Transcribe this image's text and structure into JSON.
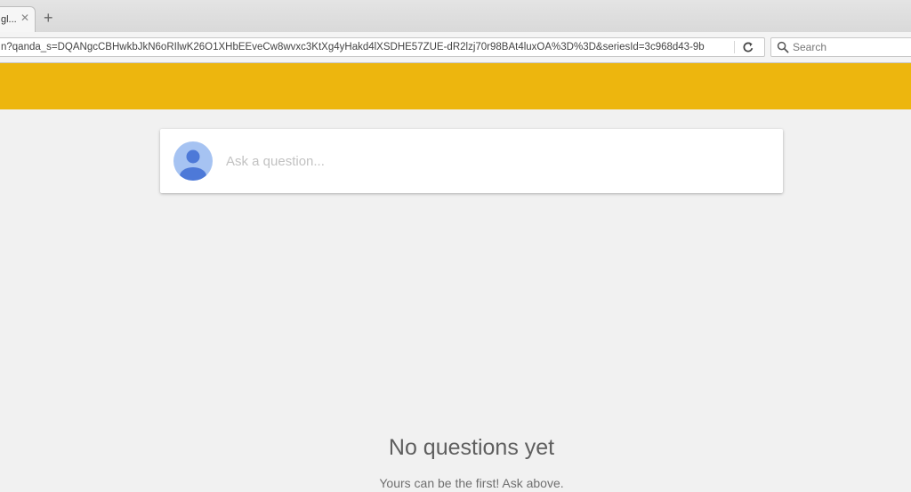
{
  "tab": {
    "title": "gl...",
    "close_glyph": "✕",
    "new_tab_glyph": "+"
  },
  "toolbar": {
    "url": "n?qanda_s=DQANgcCBHwkbJkN6oRIlwK26O1XHbEEveCw8wvxc3KtXg4yHakd4lXSDHE57ZUE-dR2lzj70r98BAt4luxOA%3D%3D&seriesId=3c968d43-9b",
    "reload_icon": "reload-icon",
    "search_placeholder": "Search",
    "search_icon": "search-icon"
  },
  "page": {
    "header_color": "#edb60e",
    "ask_placeholder": "Ask a question...",
    "avatar_icon": "user-avatar-icon",
    "empty_title": "No questions yet",
    "empty_subtitle": "Yours can be the first! Ask above."
  }
}
